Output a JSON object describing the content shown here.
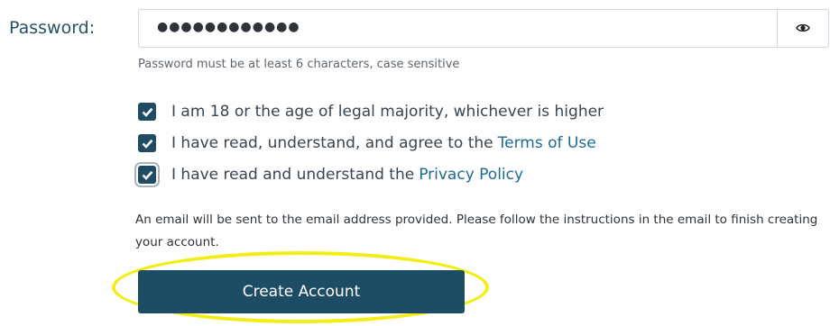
{
  "password": {
    "label": "Password:",
    "masked_value": "●●●●●●●●●●●●",
    "hint": "Password must be at least 6 characters, case sensitive",
    "toggle_icon": "eye-icon"
  },
  "agreements": [
    {
      "text": "I am 18 or the age of legal majority, whichever is higher",
      "link": "",
      "checked": true
    },
    {
      "text": "I have read, understand, and agree to the",
      "link": "Terms of Use",
      "checked": true
    },
    {
      "text": "I have read and understand the",
      "link": "Privacy Policy",
      "checked": true
    }
  ],
  "info_text": "An email will be sent to the email address provided. Please follow the instructions in the email to finish creating your account.",
  "create_button": {
    "label": "Create Account"
  },
  "colors": {
    "primary": "#1d4d64",
    "link": "#1b6a92",
    "highlight": "#f2ee14"
  }
}
